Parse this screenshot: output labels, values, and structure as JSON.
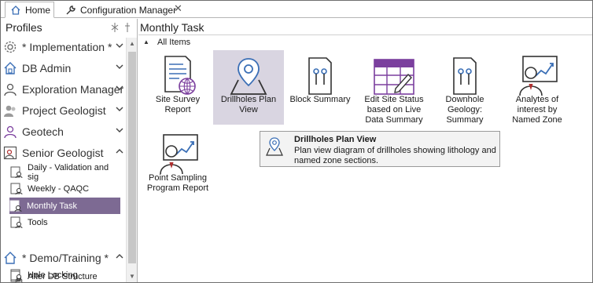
{
  "tabs": [
    {
      "label": "Home",
      "icon": "home-icon"
    },
    {
      "label": "Configuration Manager",
      "icon": "wrench-icon"
    }
  ],
  "sidebar": {
    "header": "Profiles",
    "groups": [
      {
        "label": "* Implementation *",
        "icon": "gear-icon",
        "expanded": false
      },
      {
        "label": "DB Admin",
        "icon": "database-house-icon",
        "expanded": false
      },
      {
        "label": "Exploration Manager",
        "icon": "person-icon",
        "expanded": false
      },
      {
        "label": "Project Geologist",
        "icon": "people-icon",
        "expanded": false
      },
      {
        "label": "Geotech",
        "icon": "person-tie-icon",
        "expanded": false
      },
      {
        "label": "Senior Geologist",
        "icon": "presenter-icon",
        "expanded": true,
        "items": [
          {
            "label": "Daily - Validation and sig",
            "icon": "report-icon"
          },
          {
            "label": "Weekly - QAQC",
            "icon": "report-icon"
          },
          {
            "label": "Monthly Task",
            "icon": "report-icon",
            "selected": true
          },
          {
            "label": "Tools",
            "icon": "report-icon"
          }
        ]
      },
      {
        "label": "* Demo/Training *",
        "icon": "house-icon",
        "expanded": true,
        "items": [
          {
            "label": "Alter DB Structure",
            "icon": "report-icon"
          },
          {
            "label": "Hole Locking",
            "icon": "report-icon"
          }
        ]
      }
    ]
  },
  "main": {
    "title": "Monthly Task",
    "section": "All Items",
    "tiles": [
      {
        "label": "Site Survey Report",
        "icon": "document-globe-icon"
      },
      {
        "label": "Drillholes Plan View",
        "icon": "map-pin-icon",
        "selected": true
      },
      {
        "label": "Block Summary",
        "icon": "document-pins-icon"
      },
      {
        "label": "Edit Site Status based on Live Data Summary",
        "icon": "table-edit-icon"
      },
      {
        "label": "Downhole Geology: Summary",
        "icon": "document-pins-icon"
      },
      {
        "label": "Analytes of interest by Named Zone",
        "icon": "presenter-chart-icon"
      },
      {
        "label": "Point Sampling Program Report",
        "icon": "presenter-chart-icon"
      }
    ],
    "tooltip": {
      "title": "Drillholes Plan View",
      "description": "Plan view diagram of drillholes showing lithology and named zone sections."
    }
  },
  "colors": {
    "selected_item": "#7d6a93",
    "selected_tile": "#d9d5e1",
    "accent_purple": "#7b3f9e"
  }
}
